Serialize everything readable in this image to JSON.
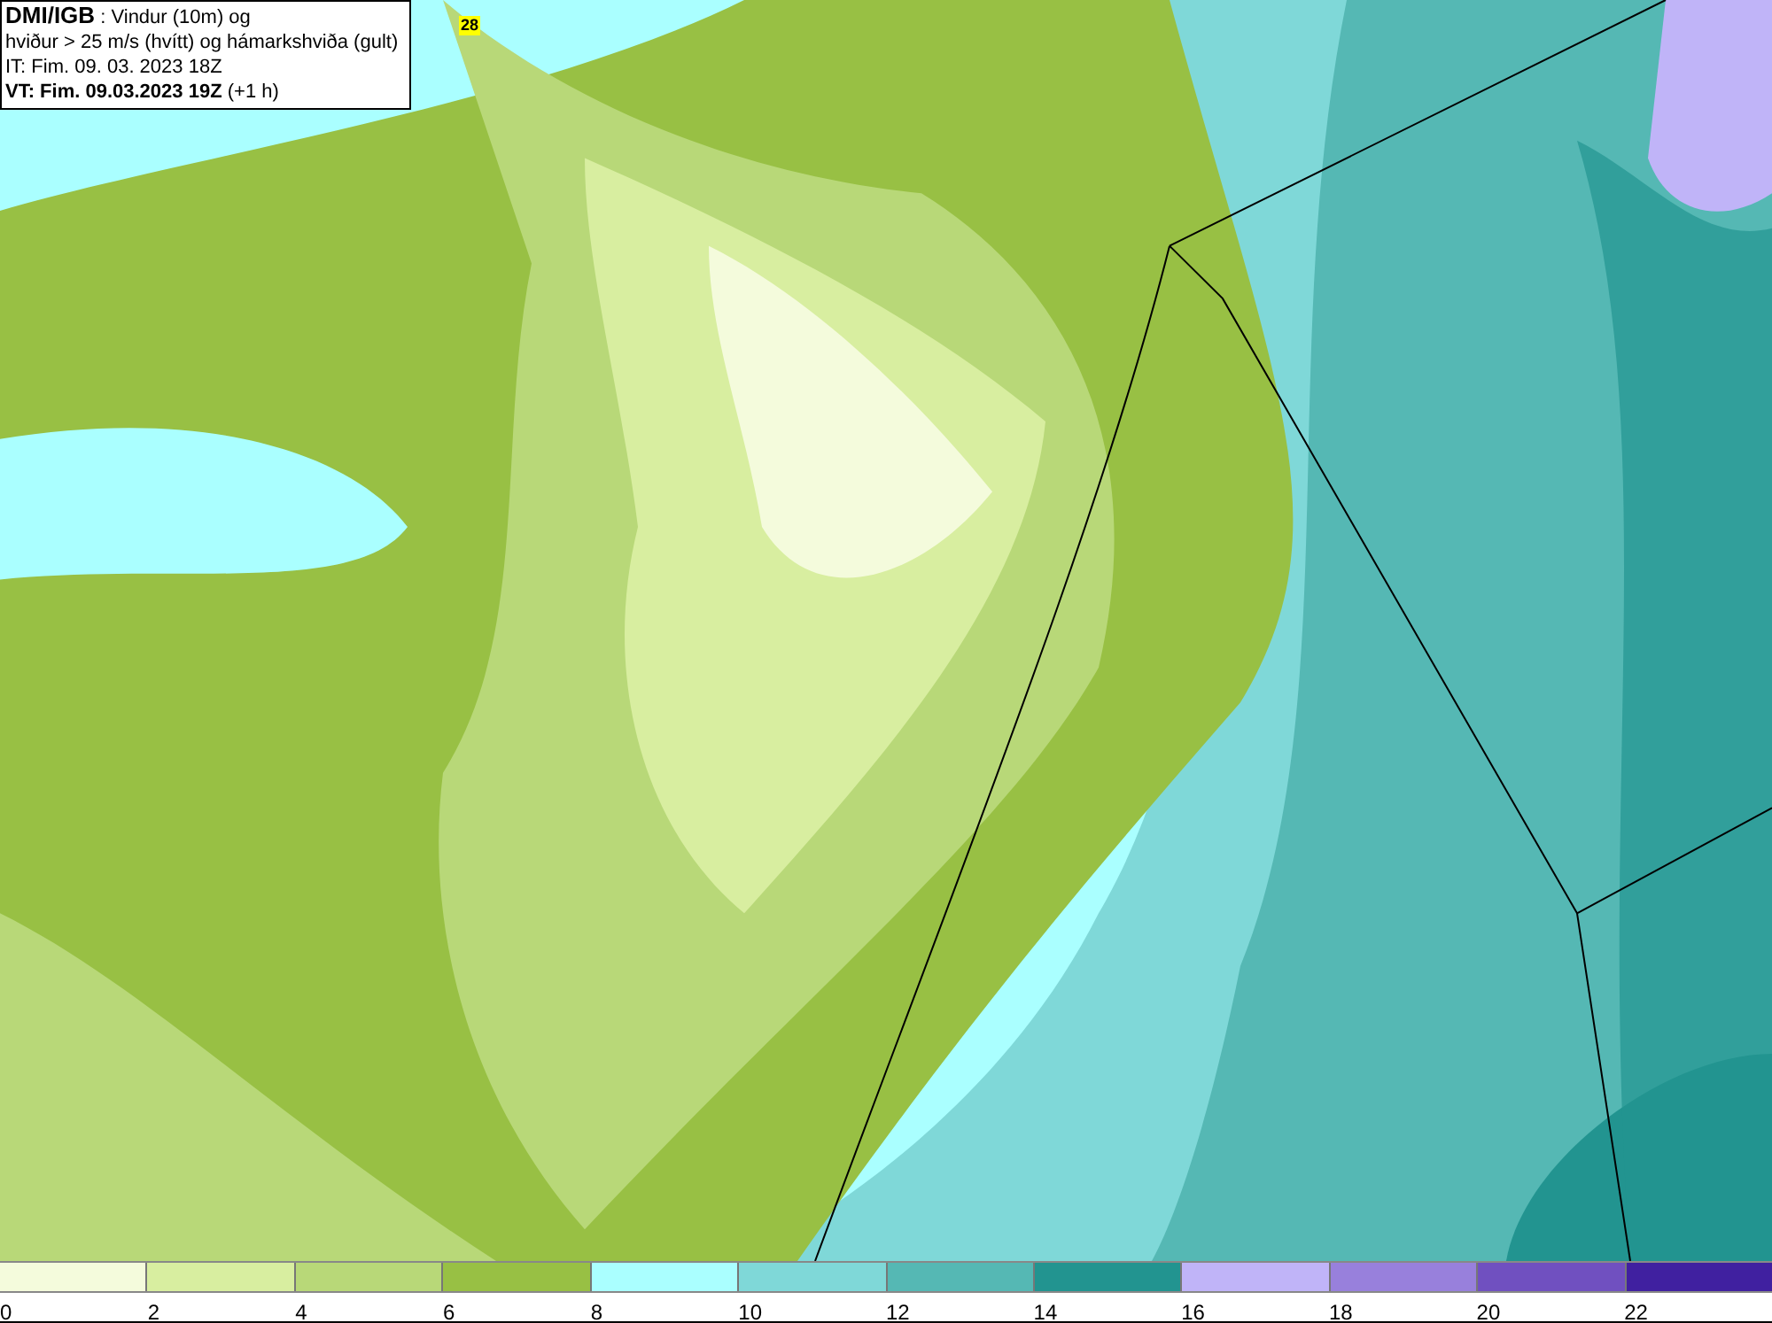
{
  "header": {
    "source": "DMI/IGB",
    "title_rest": " : Vindur (10m) og",
    "line2": "hviður > 25 m/s (hvítt) og hámarkshviða (gult)",
    "issue_time": "IT: Fim. 09. 03. 2023 18Z",
    "valid_time": "VT: Fim. 09.03.2023 19Z",
    "valid_offset": " (+1 h)"
  },
  "map": {
    "gust_badge": "28"
  },
  "legend": {
    "bins": [
      {
        "color": "#f4fbdc",
        "label": "0"
      },
      {
        "color": "#d8eea0",
        "label": "2"
      },
      {
        "color": "#b8d878",
        "label": "4"
      },
      {
        "color": "#98c044",
        "label": "6"
      },
      {
        "color": "#aaffff",
        "label": "8"
      },
      {
        "color": "#7fd8d8",
        "label": "10"
      },
      {
        "color": "#55b8b4",
        "label": "12"
      },
      {
        "color": "#229490",
        "label": "14"
      },
      {
        "color": "#c0b4f8",
        "label": "16"
      },
      {
        "color": "#9880dc",
        "label": "18"
      },
      {
        "color": "#7050c0",
        "label": "20"
      },
      {
        "color": "#4020a0",
        "label": "22"
      }
    ]
  }
}
